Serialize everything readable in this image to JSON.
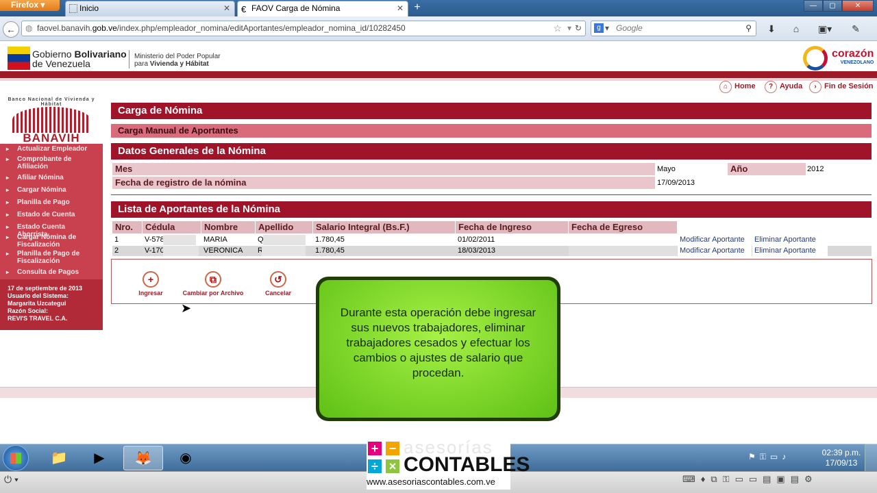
{
  "browser": {
    "menu_label": "Firefox",
    "tabs": [
      {
        "label": "Inicio"
      },
      {
        "label": "FAOV Carga de Nómina"
      }
    ],
    "url_prefix": "faovel.banavih.",
    "url_domain": "gob.ve",
    "url_path": "/index.php/empleador_nomina/editAportantes/empleador_nomina_id/10282450",
    "search_placeholder": "Google"
  },
  "header": {
    "gov_name_line1": "Gobierno ",
    "gov_name_bold": "Bolivariano",
    "gov_name_line2": "de Venezuela",
    "ministry_line1": "Ministerio del Poder Popular",
    "ministry_line2_prefix": "para ",
    "ministry_line2_bold": "Vivienda y Hábitat",
    "brand": "corazón",
    "brand_sub": "VENEZOLANO"
  },
  "topnav": [
    {
      "label": "Home",
      "icon": "home-icon"
    },
    {
      "label": "Ayuda",
      "icon": "help-icon"
    },
    {
      "label": "Fin de Sesión",
      "icon": "logout-icon"
    }
  ],
  "sidebar": {
    "logo_text": "BANAVIH",
    "logo_arc": "Banco Nacional de Vivienda y Hábitat",
    "items": [
      {
        "label": "Actualizar Empleador"
      },
      {
        "label": "Comprobante de Afiliación"
      },
      {
        "label": "Afiliar Nómina"
      },
      {
        "label": "Cargar Nómina"
      },
      {
        "label": "Planilla de Pago"
      },
      {
        "label": "Estado de Cuenta"
      },
      {
        "label": "Estado Cuenta Ahorrista"
      },
      {
        "label": "Cargar Nómina de Fiscalización"
      },
      {
        "label": "Planilla de Pago de Fiscalización"
      },
      {
        "label": "Consulta de Pagos"
      }
    ],
    "info": {
      "date": "17 de septiembre de 2013",
      "user_label": "Usuario del Sistema:",
      "user_name": "Margarita Uzcategui",
      "company_label": "Razón Social:",
      "company_name": "REVI'S TRAVEL C.A."
    }
  },
  "main": {
    "title": "Carga de Nómina",
    "subtitle": "Carga Manual de Aportantes",
    "general_title": "Datos Generales de la Nómina",
    "mes_label": "Mes",
    "mes_value": "Mayo",
    "anio_label": "Año",
    "anio_value": "2012",
    "fecha_label": "Fecha de registro de la nómina",
    "fecha_value": "17/09/2013",
    "list_title": "Lista de Aportantes de la Nómina",
    "columns": [
      "Nro.",
      "Cédula",
      "Nombre",
      "Apellido",
      "Salario Integral (Bs.F.)",
      "Fecha de Ingreso",
      "Fecha de Egreso"
    ],
    "rows": [
      {
        "nro": "1",
        "cedula": "V-578",
        "nombre": "MARIA",
        "apellido": "Q",
        "salario": "1.780,45",
        "ingreso": "01/02/2011",
        "egreso": "",
        "modify": "Modificar Aportante",
        "delete": "Eliminar Aportante"
      },
      {
        "nro": "2",
        "cedula": "V-170",
        "nombre": "VERONICA",
        "apellido": "R",
        "salario": "1.780,45",
        "ingreso": "18/03/2013",
        "egreso": "",
        "modify": "Modificar Aportante",
        "delete": "Eliminar Aportante"
      }
    ],
    "actions": [
      {
        "label": "Ingresar",
        "icon": "add-icon"
      },
      {
        "label": "Cambiar por Archivo",
        "icon": "file-icon"
      },
      {
        "label": "Cancelar",
        "icon": "cancel-icon"
      }
    ]
  },
  "callout": {
    "text": "Durante esta operación debe ingresar sus nuevos trabajadores, eliminar trabajadores cesados y efectuar los cambios o ajustes de salario que procedan."
  },
  "taskbar": {
    "time": "02:39 p.m.",
    "date": "17/09/13"
  },
  "watermark": {
    "line1": "asesorías",
    "line2": "CONTABLES",
    "url": "www.asesoriascontables.com.ve"
  }
}
